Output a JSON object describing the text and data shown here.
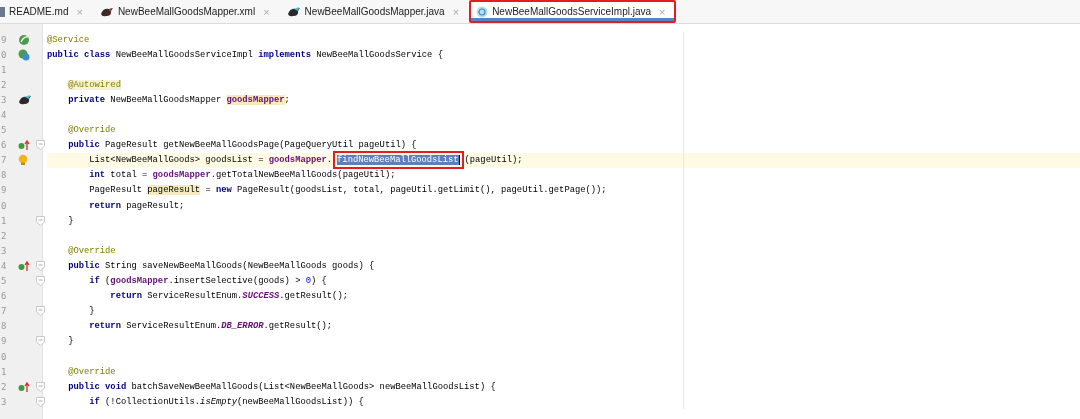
{
  "tabs": [
    {
      "label": "README.md",
      "kind": "markdown",
      "selected": false,
      "boxed": false,
      "close": "×"
    },
    {
      "label": "NewBeeMallGoodsMapper.xml",
      "kind": "mapperxml",
      "selected": false,
      "boxed": false,
      "close": "×"
    },
    {
      "label": "NewBeeMallGoodsMapper.java",
      "kind": "mapper",
      "selected": false,
      "boxed": false,
      "close": "×"
    },
    {
      "label": "NewBeeMallGoodsServiceImpl.java",
      "kind": "class",
      "selected": true,
      "boxed": true,
      "close": "×"
    }
  ],
  "lines": [
    {
      "num": "9",
      "kind": "bean",
      "fold": false,
      "current": false,
      "tokens": [
        {
          "kind": "annotation",
          "text": "@Service"
        }
      ]
    },
    {
      "num": "0",
      "kind": "beanweb",
      "fold": false,
      "current": false,
      "tokens": [
        {
          "kind": "keyword",
          "text": "public class"
        },
        {
          "kind": "plain",
          "text": " NewBeeMallGoodsServiceImpl "
        },
        {
          "kind": "keyword",
          "text": "implements"
        },
        {
          "kind": "plain",
          "text": " NewBeeMallGoodsService {"
        }
      ]
    },
    {
      "num": "1",
      "kind": "code",
      "fold": false,
      "current": false
    },
    {
      "num": "2",
      "kind": "code",
      "fold": false,
      "current": false,
      "tokens": [
        {
          "kind": "annotation-marked",
          "text": "    @Autowired"
        }
      ]
    },
    {
      "num": "3",
      "kind": "mapper",
      "fold": false,
      "current": false,
      "tokens": [
        {
          "kind": "keyword",
          "text": "    private"
        },
        {
          "kind": "plain",
          "text": " NewBeeMallGoodsMapper "
        },
        {
          "kind": "field-usage",
          "text": "goodsMapper"
        },
        {
          "kind": "plain",
          "text": ";"
        }
      ]
    },
    {
      "num": "4",
      "kind": "code",
      "fold": false,
      "current": false
    },
    {
      "num": "5",
      "kind": "code",
      "fold": false,
      "current": false,
      "tokens": [
        {
          "kind": "annotation",
          "text": "    @Override"
        }
      ]
    },
    {
      "num": "6",
      "kind": "override",
      "fold": true,
      "current": false,
      "tokens": [
        {
          "kind": "keyword",
          "text": "    public"
        },
        {
          "kind": "plain",
          "text": " PageResult getNewBeeMallGoodsPage(PageQueryUtil pageUtil) {"
        }
      ]
    },
    {
      "num": "7",
      "kind": "bulb",
      "fold": false,
      "current": true,
      "tokens": [
        {
          "kind": "plain",
          "text": "        List<NewBeeMallGoods> goodsList = "
        },
        {
          "kind": "field",
          "text": "goodsMapper"
        },
        {
          "kind": "plain",
          "text": "."
        },
        {
          "kind": "selection",
          "text": "findNewBeeMallGoodsList",
          "boxed": true
        },
        {
          "kind": "plain",
          "text": "(pageUtil);"
        }
      ]
    },
    {
      "num": "8",
      "kind": "code",
      "fold": false,
      "current": false,
      "tokens": [
        {
          "kind": "keyword",
          "text": "        int"
        },
        {
          "kind": "plain",
          "text": " total = "
        },
        {
          "kind": "field",
          "text": "goodsMapper"
        },
        {
          "kind": "plain",
          "text": ".getTotalNewBeeMallGoods(pageUtil);"
        }
      ]
    },
    {
      "num": "9",
      "kind": "code",
      "fold": false,
      "current": false,
      "tokens": [
        {
          "kind": "plain",
          "text": "        PageResult "
        },
        {
          "kind": "usage",
          "text": "pageResult"
        },
        {
          "kind": "plain",
          "text": " = "
        },
        {
          "kind": "keyword",
          "text": "new"
        },
        {
          "kind": "plain",
          "text": " PageResult(goodsList, total, pageUtil.getLimit(), pageUtil.getPage());"
        }
      ]
    },
    {
      "num": "0",
      "kind": "code",
      "fold": false,
      "current": false,
      "tokens": [
        {
          "kind": "keyword",
          "text": "        return"
        },
        {
          "kind": "plain",
          "text": " pageResult;"
        }
      ]
    },
    {
      "num": "1",
      "kind": "code",
      "fold": true,
      "current": false,
      "tokens": [
        {
          "kind": "plain",
          "text": "    }"
        }
      ]
    },
    {
      "num": "2",
      "kind": "code",
      "fold": false,
      "current": false
    },
    {
      "num": "3",
      "kind": "code",
      "fold": false,
      "current": false,
      "tokens": [
        {
          "kind": "annotation",
          "text": "    @Override"
        }
      ]
    },
    {
      "num": "4",
      "kind": "override",
      "fold": true,
      "current": false,
      "tokens": [
        {
          "kind": "keyword",
          "text": "    public"
        },
        {
          "kind": "plain",
          "text": " String saveNewBeeMallGoods(NewBeeMallGoods goods) {"
        }
      ]
    },
    {
      "num": "5",
      "kind": "code",
      "fold": true,
      "current": false,
      "tokens": [
        {
          "kind": "keyword",
          "text": "        if"
        },
        {
          "kind": "plain",
          "text": " ("
        },
        {
          "kind": "field",
          "text": "goodsMapper"
        },
        {
          "kind": "plain",
          "text": ".insertSelective(goods) > "
        },
        {
          "kind": "number",
          "text": "0"
        },
        {
          "kind": "plain",
          "text": ") {"
        }
      ]
    },
    {
      "num": "6",
      "kind": "code",
      "fold": false,
      "current": false,
      "tokens": [
        {
          "kind": "keyword",
          "text": "            return"
        },
        {
          "kind": "plain",
          "text": " ServiceResultEnum."
        },
        {
          "kind": "static",
          "text": "SUCCESS"
        },
        {
          "kind": "plain",
          "text": ".getResult();"
        }
      ]
    },
    {
      "num": "7",
      "kind": "code",
      "fold": true,
      "current": false,
      "tokens": [
        {
          "kind": "plain",
          "text": "        }"
        }
      ]
    },
    {
      "num": "8",
      "kind": "code",
      "fold": false,
      "current": false,
      "tokens": [
        {
          "kind": "keyword",
          "text": "        return"
        },
        {
          "kind": "plain",
          "text": " ServiceResultEnum."
        },
        {
          "kind": "static",
          "text": "DB_ERROR"
        },
        {
          "kind": "plain",
          "text": ".getResult();"
        }
      ]
    },
    {
      "num": "9",
      "kind": "code",
      "fold": true,
      "current": false,
      "tokens": [
        {
          "kind": "plain",
          "text": "    }"
        }
      ]
    },
    {
      "num": "0",
      "kind": "code",
      "fold": false,
      "current": false
    },
    {
      "num": "1",
      "kind": "code",
      "fold": false,
      "current": false,
      "tokens": [
        {
          "kind": "annotation",
          "text": "    @Override"
        }
      ]
    },
    {
      "num": "2",
      "kind": "override",
      "fold": true,
      "current": false,
      "tokens": [
        {
          "kind": "keyword",
          "text": "    public void"
        },
        {
          "kind": "plain",
          "text": " batchSaveNewBeeMallGoods(List<NewBeeMallGoods> newBeeMallGoodsList) {"
        }
      ]
    },
    {
      "num": "3",
      "kind": "code",
      "fold": true,
      "current": false,
      "tokens": [
        {
          "kind": "keyword",
          "text": "        if"
        },
        {
          "kind": "plain",
          "text": " (!CollectionUtils."
        },
        {
          "kind": "static-method",
          "text": "isEmpty"
        },
        {
          "kind": "plain",
          "text": "(newBeeMallGoodsList)) {"
        }
      ]
    }
  ]
}
